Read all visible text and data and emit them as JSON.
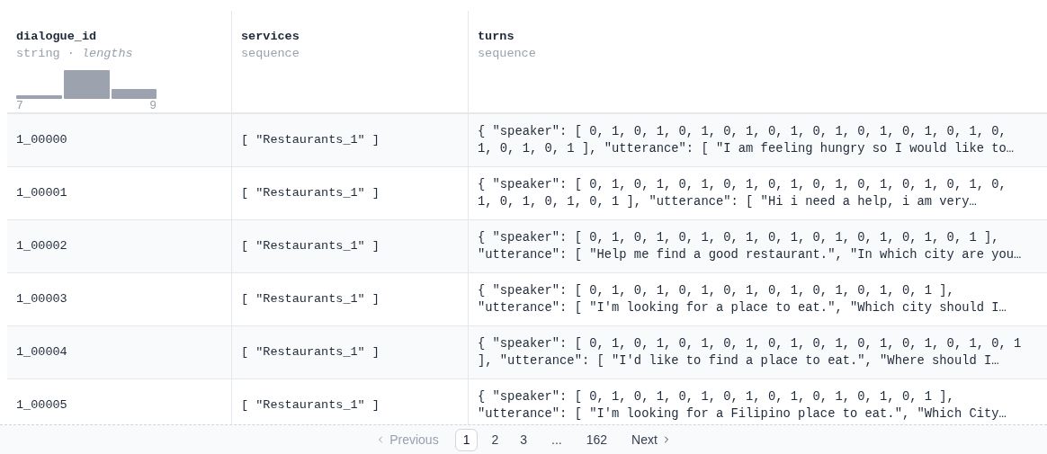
{
  "columns": [
    {
      "name": "dialogue_id",
      "type": "string",
      "separator": "·",
      "type_note": "lengths",
      "histogram": {
        "min_label": "7",
        "max_label": "9"
      }
    },
    {
      "name": "services",
      "type": "sequence"
    },
    {
      "name": "turns",
      "type": "sequence"
    }
  ],
  "rows": [
    {
      "dialogue_id": "1_00000",
      "services": "[ \"Restaurants_1\" ]",
      "turns": [
        "{ \"speaker\": [ 0, 1, 0, 1, 0, 1, 0, 1, 0, 1, 0, 1, 0, 1, 0, 1, 0, 1, 0,",
        "1, 0, 1, 0, 1 ], \"utterance\": [ \"I am feeling hungry so I would like to…"
      ]
    },
    {
      "dialogue_id": "1_00001",
      "services": "[ \"Restaurants_1\" ]",
      "turns": [
        "{ \"speaker\": [ 0, 1, 0, 1, 0, 1, 0, 1, 0, 1, 0, 1, 0, 1, 0, 1, 0, 1, 0,",
        "1, 0, 1, 0, 1, 0, 1 ], \"utterance\": [ \"Hi i need a help, i am very…"
      ]
    },
    {
      "dialogue_id": "1_00002",
      "services": "[ \"Restaurants_1\" ]",
      "turns": [
        "{ \"speaker\": [ 0, 1, 0, 1, 0, 1, 0, 1, 0, 1, 0, 1, 0, 1, 0, 1, 0, 1 ],",
        "\"utterance\": [ \"Help me find a good restaurant.\", \"In which city are you…"
      ]
    },
    {
      "dialogue_id": "1_00003",
      "services": "[ \"Restaurants_1\" ]",
      "turns": [
        "{ \"speaker\": [ 0, 1, 0, 1, 0, 1, 0, 1, 0, 1, 0, 1, 0, 1, 0, 1 ],",
        "\"utterance\": [ \"I'm looking for a place to eat.\", \"Which city should I…"
      ]
    },
    {
      "dialogue_id": "1_00004",
      "services": "[ \"Restaurants_1\" ]",
      "turns": [
        "{ \"speaker\": [ 0, 1, 0, 1, 0, 1, 0, 1, 0, 1, 0, 1, 0, 1, 0, 1, 0, 1, 0, 1",
        "], \"utterance\": [ \"I'd like to find a place to eat.\", \"Where should I…"
      ]
    },
    {
      "dialogue_id": "1_00005",
      "services": "[ \"Restaurants_1\" ]",
      "turns": [
        "{ \"speaker\": [ 0, 1, 0, 1, 0, 1, 0, 1, 0, 1, 0, 1, 0, 1, 0, 1 ],",
        "\"utterance\": [ \"I'm looking for a Filipino place to eat.\", \"Which City…"
      ]
    }
  ],
  "pagination": {
    "previous": {
      "label": "Previous",
      "disabled": true
    },
    "pages": [
      {
        "label": "1",
        "selected": true
      },
      {
        "label": "2",
        "selected": false
      },
      {
        "label": "3",
        "selected": false
      },
      {
        "label": "...",
        "kind": "ellipsis"
      },
      {
        "label": "162",
        "selected": false
      }
    ],
    "next": {
      "label": "Next",
      "disabled": false
    }
  }
}
